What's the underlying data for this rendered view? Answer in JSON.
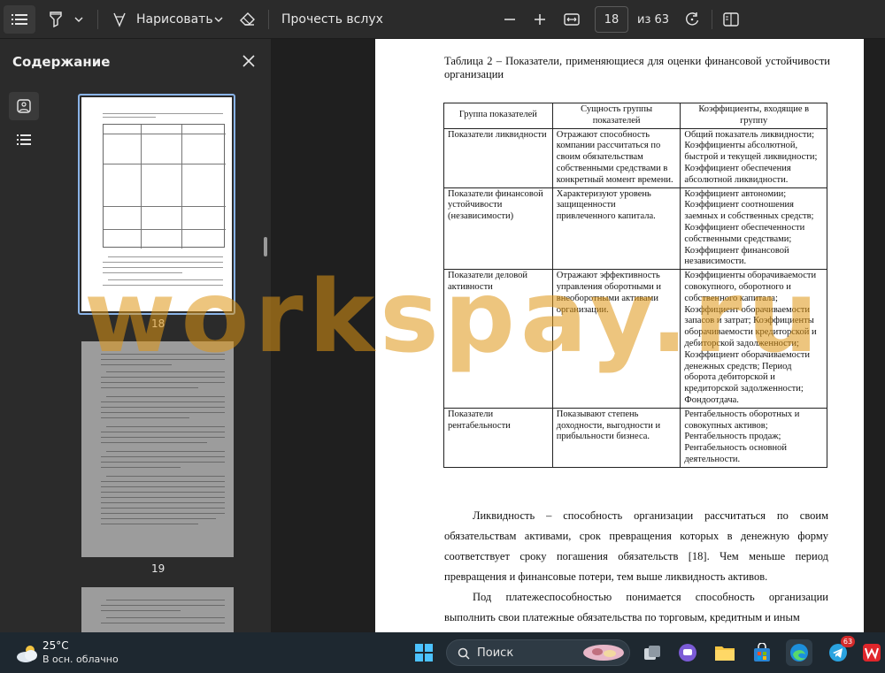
{
  "toolbar": {
    "draw_label": "Нарисовать",
    "read_aloud_label": "Прочесть вслух",
    "current_page": "18",
    "page_total": "из 63"
  },
  "sidebar": {
    "title": "Содержание",
    "thumbnails": [
      {
        "page": "18"
      },
      {
        "page": "19"
      }
    ]
  },
  "document": {
    "caption": "Таблица 2 – Показатели, применяющиеся для оценки финансовой устойчивости организации",
    "table": {
      "headers": [
        "Группа показателей",
        "Сущность группы показателей",
        "Коэффициенты, входящие в группу"
      ],
      "rows": [
        [
          "Показатели ликвидности",
          "Отражают способность компании рассчитаться по своим обязательствам собственными средствами в конкретный момент времени.",
          "Общий показатель ликвидности; Коэффициенты абсолютной, быстрой и текущей ликвидности; Коэффициент обеспечения абсолютной ликвидности."
        ],
        [
          "Показатели финансовой устойчивости (независимости)",
          "Характеризуют уровень защищенности привлеченного капитала.",
          "Коэффициент автономии; Коэффициент соотношения заемных и собственных средств; Коэффициент обеспеченности собственными средствами; Коэффициент финансовой независимости."
        ],
        [
          "Показатели деловой активности",
          "Отражают эффективность управления оборотными и внеоборотными активами организации.",
          "Коэффициенты оборачиваемости совокупного, оборотного и собственного капитала; Коэффициент оборачиваемости запасов и затрат; Коэффициенты оборачиваемости кредиторской и дебиторской задолженности; Коэффициент оборачиваемости денежных средств; Период оборота дебиторской и кредиторской задолженности; Фондоотдача."
        ],
        [
          "Показатели рентабельности",
          "Показывают степень доходности, выгодности и прибыльности бизнеса.",
          "Рентабельность оборотных и совокупных активов; Рентабельность продаж; Рентабельность основной деятельности."
        ]
      ]
    },
    "paragraph1": "Ликвидность – способность организации рассчитаться по своим обязательствам активами, срок превращения которых в денежную форму соответствует сроку погашения обязательств [18]. Чем меньше период превращения и финансовые потери, тем выше ликвидность активов.",
    "paragraph2": "Под платежеспособностью понимается способность организации выполнить свои платежные обязательства по торговым, кредитным и иным"
  },
  "watermark": "workspay.ru",
  "taskbar": {
    "temperature": "25°C",
    "weather": "В осн. облачно",
    "search_placeholder": "Поиск",
    "telegram_badge": "63"
  }
}
